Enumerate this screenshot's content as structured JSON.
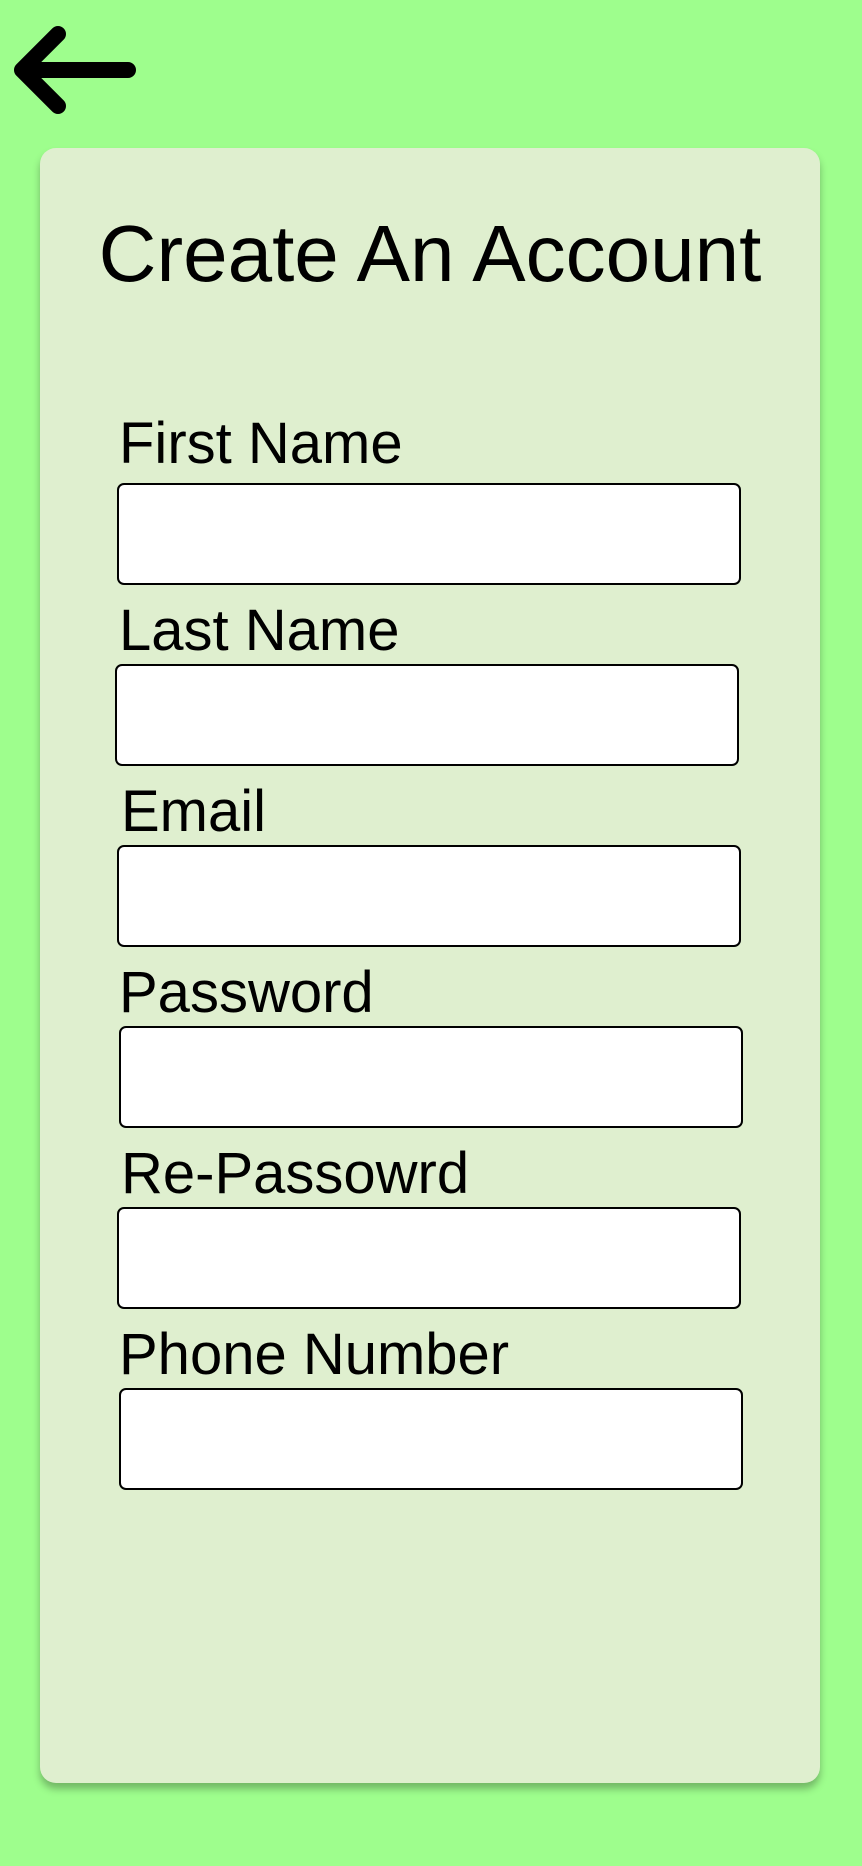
{
  "colors": {
    "background": "#9efe8d",
    "card": "#dfefcf",
    "input_background": "#ffffff",
    "text": "#000000"
  },
  "header": {
    "back_icon": "arrow-left-icon"
  },
  "form": {
    "title": "Create An Account",
    "fields": [
      {
        "label": "First Name",
        "value": "",
        "placeholder": ""
      },
      {
        "label": "Last Name",
        "value": "",
        "placeholder": ""
      },
      {
        "label": "Email",
        "value": "",
        "placeholder": ""
      },
      {
        "label": "Password",
        "value": "",
        "placeholder": ""
      },
      {
        "label": "Re-Passowrd",
        "value": "",
        "placeholder": ""
      },
      {
        "label": "Phone Number",
        "value": "",
        "placeholder": ""
      }
    ]
  }
}
